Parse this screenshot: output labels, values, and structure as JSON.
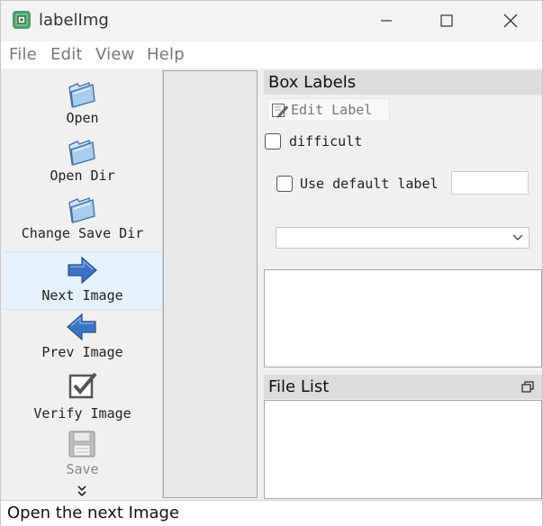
{
  "window": {
    "title": "labelImg"
  },
  "menu": {
    "file": "File",
    "edit": "Edit",
    "view": "View",
    "help": "Help"
  },
  "toolbar": {
    "items": [
      {
        "label": "Open",
        "icon": "folder-open-icon"
      },
      {
        "label": "Open Dir",
        "icon": "folder-open-icon"
      },
      {
        "label": "Change Save Dir",
        "icon": "folder-open-icon"
      },
      {
        "label": "Next Image",
        "icon": "arrow-right-icon",
        "state": "hovered"
      },
      {
        "label": "Prev Image",
        "icon": "arrow-left-icon"
      },
      {
        "label": "Verify Image",
        "icon": "checkbox-checked-icon"
      },
      {
        "label": "Save",
        "icon": "floppy-disk-icon",
        "state": "disabled"
      }
    ],
    "more_icon": "chevron-double-down-icon"
  },
  "box_labels": {
    "title": "Box Labels",
    "edit_label": "Edit Label",
    "difficult": "difficult",
    "use_default_label": "Use default label",
    "default_label_value": "",
    "combo_value": ""
  },
  "file_list": {
    "title": "File List"
  },
  "status": {
    "text": "Open the next Image"
  },
  "colors": {
    "active_tool_bg": "#e5f1fb",
    "dock_title_bg": "#dcdcdc",
    "arrow_blue": "#3c74c4"
  }
}
